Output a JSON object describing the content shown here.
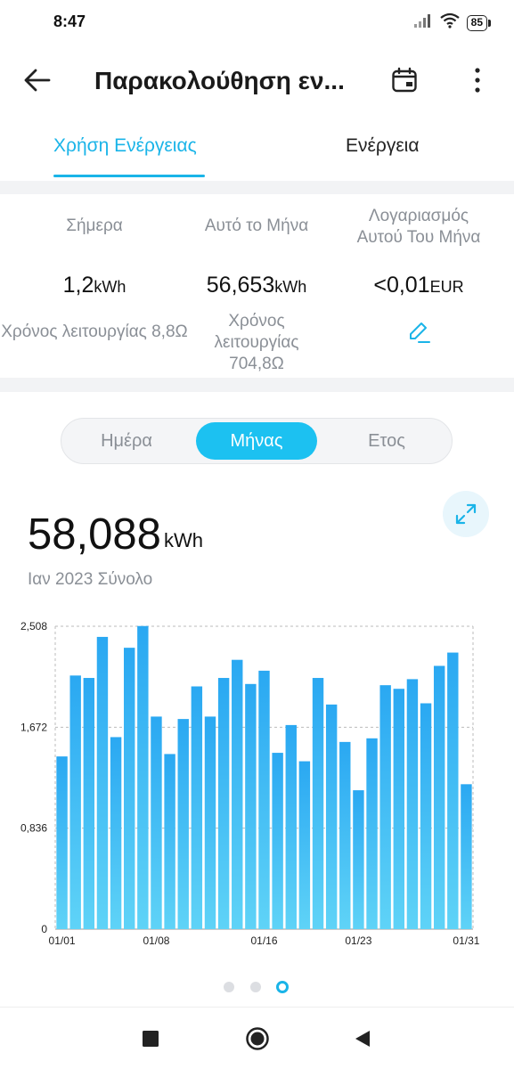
{
  "status": {
    "time": "8:47",
    "battery": "85"
  },
  "app_bar": {
    "title": "Παρακολούθηση εν..."
  },
  "tabs": [
    {
      "label": "Χρήση Ενέργειας",
      "active": true
    },
    {
      "label": "Ενέργεια",
      "active": false
    }
  ],
  "stats": {
    "today": {
      "label": "Σήμερα",
      "value": "1,2",
      "unit": "kWh",
      "sub": "Χρόνος λειτουργίας 8,8Ω"
    },
    "month": {
      "label": "Αυτό το Μήνα",
      "value": "56,653",
      "unit": "kWh",
      "sub": "Χρόνος λειτουργίας 704,8Ω"
    },
    "bill": {
      "label": "Λογαριασμός Αυτού Του Μήνα",
      "value": "<0,01",
      "unit": "EUR"
    }
  },
  "period_selector": {
    "options": [
      "Ημέρα",
      "Μήνας",
      "Ετος"
    ],
    "selected": "Μήνας"
  },
  "summary": {
    "total": "58,088",
    "unit": "kWh",
    "label": "Ιαν 2023 Σύνολο"
  },
  "colors": {
    "accent": "#1ab4e8",
    "bar_top": "#2aa8f2",
    "bar_bottom": "#5fd3f7"
  },
  "chart_data": {
    "type": "bar",
    "x": [
      "01/01",
      "01/02",
      "01/03",
      "01/04",
      "01/05",
      "01/06",
      "01/07",
      "01/08",
      "01/09",
      "01/10",
      "01/11",
      "01/12",
      "01/13",
      "01/14",
      "01/15",
      "01/16",
      "01/17",
      "01/18",
      "01/19",
      "01/20",
      "01/21",
      "01/22",
      "01/23",
      "01/24",
      "01/25",
      "01/26",
      "01/27",
      "01/28",
      "01/29",
      "01/30",
      "01/31"
    ],
    "values": [
      1.43,
      2.1,
      2.08,
      2.42,
      1.59,
      2.33,
      2.51,
      1.76,
      1.45,
      1.74,
      2.01,
      1.76,
      2.08,
      2.23,
      2.03,
      2.14,
      1.46,
      1.69,
      1.39,
      2.08,
      1.86,
      1.55,
      1.15,
      1.58,
      2.02,
      1.99,
      2.07,
      1.87,
      2.18,
      2.29,
      1.2
    ],
    "x_tick_labels": [
      "01/01",
      "01/08",
      "01/16",
      "01/23",
      "01/31"
    ],
    "y_tick_labels": [
      "0",
      "0,836",
      "1,672",
      "2,508"
    ],
    "y_ticks": [
      0,
      0.836,
      1.672,
      2.508
    ],
    "ylim": [
      0,
      2.508
    ],
    "xlabel": "",
    "ylabel": "",
    "grid": true
  },
  "pager": {
    "count": 3,
    "active": 2
  }
}
